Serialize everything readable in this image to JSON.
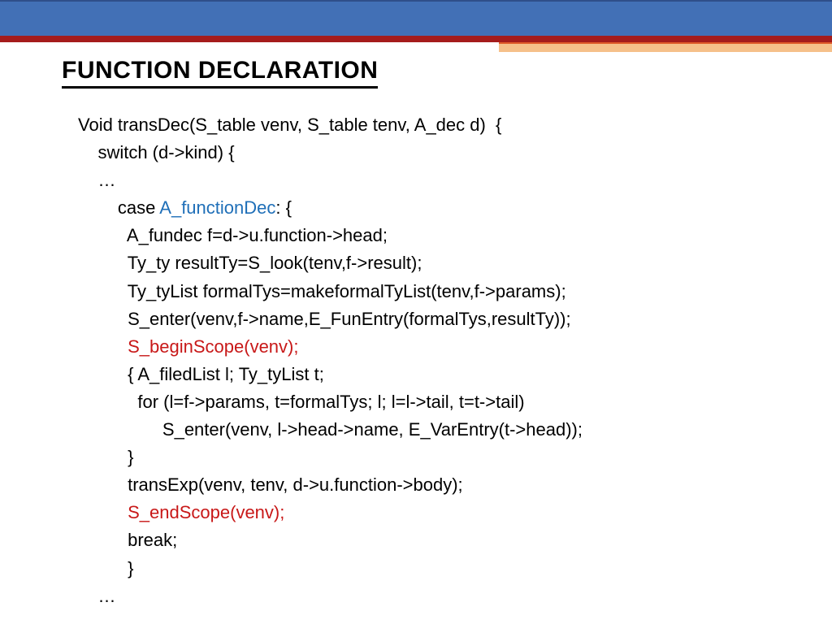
{
  "slide": {
    "title": "FUNCTION DECLARATION",
    "code": {
      "l1": "Void transDec(S_table venv, S_table tenv, A_dec d)  {",
      "l2": "    switch (d->kind) {",
      "l3": "    …",
      "l4p": "        case ",
      "l4b": "A_functionDec",
      "l4s": ": {",
      "l5": "          A_fundec f=d->u.function->head;",
      "l6": "          Ty_ty resultTy=S_look(tenv,f->result);",
      "l7": "          Ty_tyList formalTys=makeformalTyList(tenv,f->params);",
      "l8": "          S_enter(venv,f->name,E_FunEntry(formalTys,resultTy));",
      "l9": "          S_beginScope(venv);",
      "l10": "          { A_filedList l; Ty_tyList t;",
      "l11": "            for (l=f->params, t=formalTys; l; l=l->tail, t=t->tail)",
      "l12": "                 S_enter(venv, l->head->name, E_VarEntry(t->head));",
      "l13": "          }",
      "l14": "          transExp(venv, tenv, d->u.function->body);",
      "l15": "          S_endScope(venv);",
      "l16": "          break;",
      "l17": "          }",
      "l18": "    …"
    }
  },
  "colors": {
    "band_blue": "#4270b6",
    "band_red": "#a51c1c",
    "stripe_orange": "#f6c08a",
    "text_blue": "#1f6fb8",
    "text_red": "#c81818"
  }
}
